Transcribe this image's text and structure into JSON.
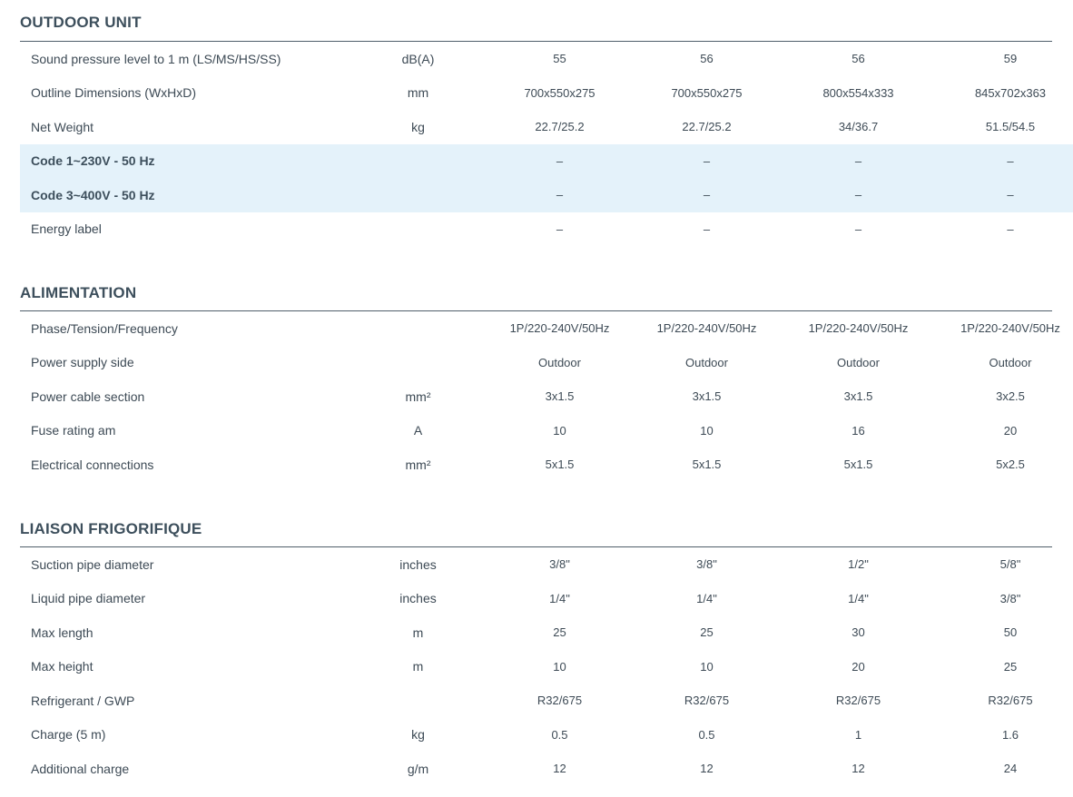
{
  "sections": [
    {
      "title": "OUTDOOR UNIT",
      "rows": [
        {
          "label": "Sound pressure level to 1 m (LS/MS/HS/SS)",
          "unit": "dB(A)",
          "values": [
            "55",
            "56",
            "56",
            "59"
          ],
          "highlight": false
        },
        {
          "label": "Outline Dimensions (WxHxD)",
          "unit": "mm",
          "values": [
            "700x550x275",
            "700x550x275",
            "800x554x333",
            "845x702x363"
          ],
          "highlight": false
        },
        {
          "label": "Net Weight",
          "unit": "kg",
          "values": [
            "22.7/25.2",
            "22.7/25.2",
            "34/36.7",
            "51.5/54.5"
          ],
          "highlight": false
        },
        {
          "label": "Code 1~230V - 50 Hz",
          "unit": "",
          "values": [
            "–",
            "–",
            "–",
            "–"
          ],
          "highlight": true
        },
        {
          "label": "Code 3~400V - 50 Hz",
          "unit": "",
          "values": [
            "–",
            "–",
            "–",
            "–"
          ],
          "highlight": true
        },
        {
          "label": "Energy label",
          "unit": "",
          "values": [
            "–",
            "–",
            "–",
            "–"
          ],
          "highlight": false
        }
      ]
    },
    {
      "title": "ALIMENTATION",
      "rows": [
        {
          "label": "Phase/Tension/Frequency",
          "unit": "",
          "values": [
            "1P/220-240V/50Hz",
            "1P/220-240V/50Hz",
            "1P/220-240V/50Hz",
            "1P/220-240V/50Hz"
          ],
          "highlight": false
        },
        {
          "label": "Power supply side",
          "unit": "",
          "values": [
            "Outdoor",
            "Outdoor",
            "Outdoor",
            "Outdoor"
          ],
          "highlight": false
        },
        {
          "label": "Power cable section",
          "unit": "mm²",
          "values": [
            "3x1.5",
            "3x1.5",
            "3x1.5",
            "3x2.5"
          ],
          "highlight": false
        },
        {
          "label": "Fuse rating am",
          "unit": "A",
          "values": [
            "10",
            "10",
            "16",
            "20"
          ],
          "highlight": false
        },
        {
          "label": "Electrical connections",
          "unit": "mm²",
          "values": [
            "5x1.5",
            "5x1.5",
            "5x1.5",
            "5x2.5"
          ],
          "highlight": false
        }
      ]
    },
    {
      "title": "LIAISON FRIGORIFIQUE",
      "rows": [
        {
          "label": "Suction pipe diameter",
          "unit": "inches",
          "values": [
            "3/8\"",
            "3/8\"",
            "1/2\"",
            "5/8\""
          ],
          "highlight": false
        },
        {
          "label": "Liquid pipe diameter",
          "unit": "inches",
          "values": [
            "1/4\"",
            "1/4\"",
            "1/4\"",
            "3/8\""
          ],
          "highlight": false
        },
        {
          "label": "Max length",
          "unit": "m",
          "values": [
            "25",
            "25",
            "30",
            "50"
          ],
          "highlight": false
        },
        {
          "label": "Max height",
          "unit": "m",
          "values": [
            "10",
            "10",
            "20",
            "25"
          ],
          "highlight": false
        },
        {
          "label": "Refrigerant / GWP",
          "unit": "",
          "values": [
            "R32/675",
            "R32/675",
            "R32/675",
            "R32/675"
          ],
          "highlight": false
        },
        {
          "label": "Charge (5 m)",
          "unit": "kg",
          "values": [
            "0.5",
            "0.5",
            "1",
            "1.6"
          ],
          "highlight": false
        },
        {
          "label": "Additional charge",
          "unit": "g/m",
          "values": [
            "12",
            "12",
            "12",
            "24"
          ],
          "highlight": false
        }
      ]
    }
  ]
}
